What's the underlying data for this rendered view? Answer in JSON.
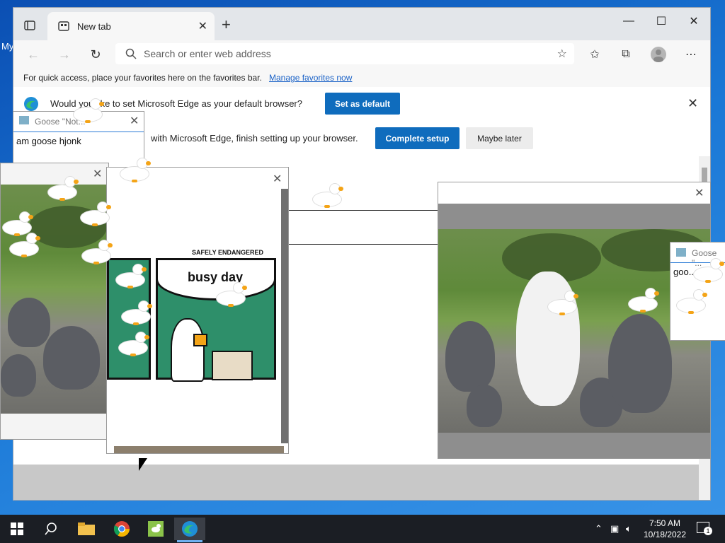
{
  "desktop": {
    "label": "My"
  },
  "browser": {
    "tab_title": "New tab",
    "address_placeholder": "Search or enter web address",
    "favbar_text": "For quick access, place your favorites here on the favorites bar.",
    "favbar_link": "Manage favorites now",
    "default_prompt": "Would you like to set Microsoft Edge as your default browser?",
    "set_default_label": "Set as default",
    "setup_prompt": "with Microsoft Edge, finish setting up your browser.",
    "complete_setup_label": "Complete setup",
    "maybe_later_label": "Maybe later"
  },
  "notes": {
    "note1_title": "Goose \"Not...",
    "note1_text": "am goose hjonk",
    "note2_title": "Goose \"...",
    "note2_text": "goo..."
  },
  "comic": {
    "brand": "SAFELY ENDANGERED",
    "caption": "busy day"
  },
  "taskbar": {
    "time": "7:50 AM",
    "date": "10/18/2022",
    "notification_count": "1"
  },
  "colors": {
    "accent": "#0f6cbd",
    "desktop_blue": "#1a78d6",
    "comic_green": "#2e8f6a",
    "goose_beak": "#f4a417"
  }
}
